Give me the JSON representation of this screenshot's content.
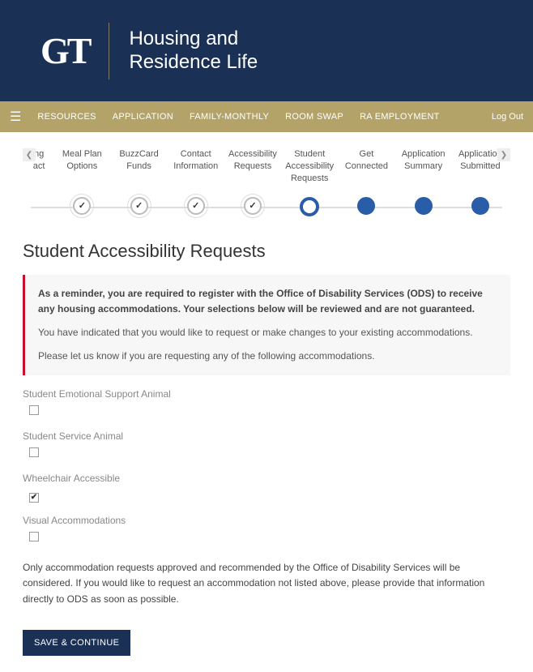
{
  "header": {
    "title_line1": "Housing and",
    "title_line2": "Residence Life",
    "logo_text": "GT"
  },
  "nav": {
    "items": [
      "RESOURCES",
      "APPLICATION",
      "FAMILY-MONTHLY",
      "ROOM SWAP",
      "RA EMPLOYMENT"
    ],
    "logout": "Log Out"
  },
  "steps": {
    "partial_left_label_line1": "ng",
    "partial_left_label_line2": "act",
    "items": [
      {
        "label_line1": "Meal Plan",
        "label_line2": "Options",
        "state": "checked"
      },
      {
        "label_line1": "BuzzCard",
        "label_line2": "Funds",
        "state": "checked"
      },
      {
        "label_line1": "Contact",
        "label_line2": "Information",
        "state": "checked"
      },
      {
        "label_line1": "Accessibility",
        "label_line2": "Requests",
        "state": "checked"
      },
      {
        "label_line1": "Student",
        "label_line2": "Accessibility",
        "label_line3": "Requests",
        "state": "current"
      },
      {
        "label_line1": "Get",
        "label_line2": "Connected",
        "state": "future"
      },
      {
        "label_line1": "Application",
        "label_line2": "Summary",
        "state": "future"
      },
      {
        "label_line1": "Application",
        "label_line2": "Submitted",
        "state": "future"
      }
    ]
  },
  "page": {
    "title": "Student Accessibility Requests",
    "alert_bold": "As a reminder, you are required to register with the Office of Disability Services (ODS) to receive any housing accommodations. Your selections below will be reviewed and are not guaranteed.",
    "alert_p1": "You have indicated that you would like to request or make changes to your existing accommodations.",
    "alert_p2": "Please let us know if you are requesting any of the following accommodations."
  },
  "fields": [
    {
      "label": "Student Emotional Support Animal",
      "checked": false
    },
    {
      "label": "Student Service Animal",
      "checked": false
    },
    {
      "label": "Wheelchair Accessible",
      "checked": true
    },
    {
      "label": "Visual Accommodations",
      "checked": false
    }
  ],
  "footer_note": "Only accommodation requests approved and recommended by the Office of Disability Services will be considered. If you would like to request an accommodation not listed above, please provide that information directly to ODS as soon as possible.",
  "submit_label": "SAVE & CONTINUE"
}
